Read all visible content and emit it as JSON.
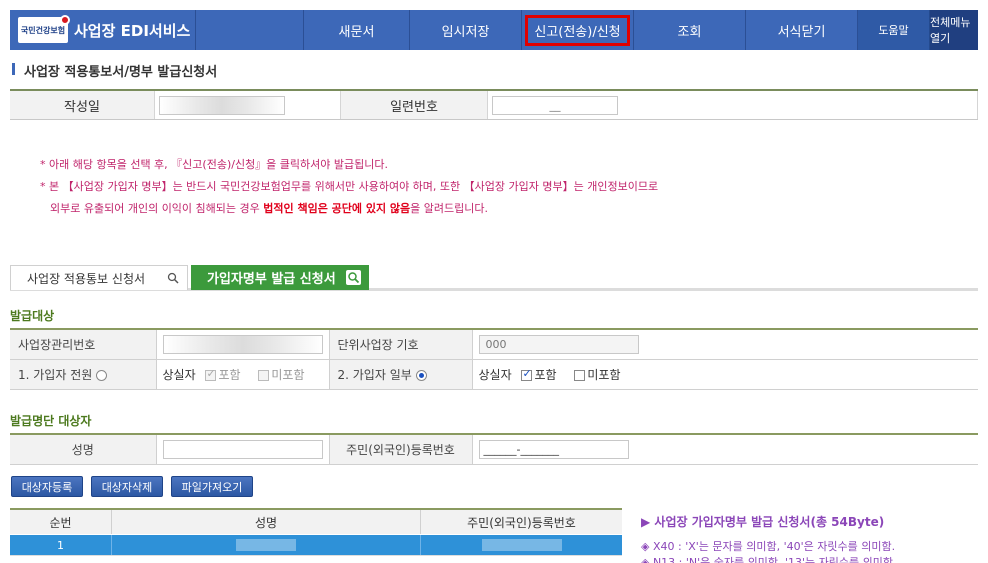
{
  "nav": {
    "brand_logo_text": "국민건강보험",
    "brand_title": "사업장 EDI서비스",
    "items": [
      "새문서",
      "임시저장",
      "신고(전송)/신청",
      "조회",
      "서식닫기"
    ],
    "help": "도움말",
    "all_menu": "전체메뉴 열기"
  },
  "page": {
    "title": "사업장 적용통보서/명부 발급신청서"
  },
  "info": {
    "date_label": "작성일",
    "serial_label": "일련번호",
    "serial_value": "__"
  },
  "notes": {
    "line1": "* 아래 해당 항목을 선택 후, 『신고(전송)/신청』을 클릭하셔야 발급됩니다.",
    "line2": "* 본 【사업장 가입자 명부】는 반드시 국민건강보험업무를 위해서만 사용하여야 하며, 또한 【사업장 가입자 명부】는 개인정보이므로",
    "line3_pre": "외부로 유출되어 개인의 이익이 침해되는 경우 ",
    "line3_bold": "법적인 책임은 공단에 있지 않음",
    "line3_post": "을 알려드립니다."
  },
  "tabs": {
    "tab1": "사업장 적용통보 신청서",
    "tab2": "가입자명부 발급 신청서"
  },
  "issue_target": {
    "section_title": "발급대상",
    "mgmt_no_label": "사업장관리번호",
    "unit_symbol_label": "단위사업장 기호",
    "unit_symbol_value": "000",
    "all_members_label": "1. 가입자 전원",
    "partial_members_label": "2. 가입자 일부",
    "loss_label": "상실자",
    "include_label": "포함",
    "exclude_label": "미포함"
  },
  "target_person": {
    "section_title": "발급명단 대상자",
    "name_label": "성명",
    "rrn_label": "주민(외국인)등록번호",
    "rrn_value": "______-_______"
  },
  "buttons": {
    "register": "대상자등록",
    "delete": "대상자삭제",
    "import": "파일가져오기"
  },
  "list": {
    "headers": [
      "순번",
      "성명",
      "주민(외국인)등록번호"
    ],
    "rows": [
      {
        "no": "1"
      }
    ]
  },
  "spec": {
    "title": "▶ 사업장 가입자명부 발급 신청서(총 54Byte)",
    "line1": "◈ X40 : 'X'는 문자를 의미함, '40'은 자릿수를 의미함.",
    "line2": "◈ N13 : 'N'은 숫자를 의미함, '13'는 자릿수를 의미함."
  },
  "colors": {
    "nav_bg": "#3d68b8",
    "active_outline": "#e00000",
    "tab_active": "#3c9a3c",
    "note_text": "#c0246b",
    "spec_text": "#8b46b8",
    "selected_row": "#2e91d8"
  }
}
